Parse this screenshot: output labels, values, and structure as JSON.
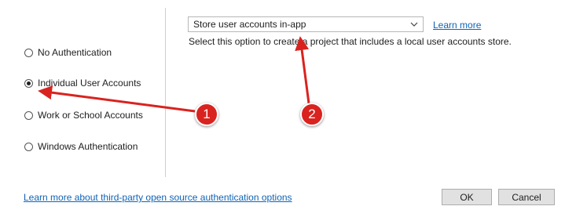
{
  "auth_options": [
    {
      "label": "No Authentication",
      "checked": false
    },
    {
      "label": "Individual User Accounts",
      "checked": true
    },
    {
      "label": "Work or School Accounts",
      "checked": false
    },
    {
      "label": "Windows Authentication",
      "checked": false
    }
  ],
  "store_select": {
    "value": "Store user accounts in-app"
  },
  "learn_more_label": "Learn more",
  "description": "Select this option to create a project that includes a local user accounts store.",
  "footer": {
    "third_party_link": "Learn more about third-party open source authentication options"
  },
  "buttons": {
    "ok": "OK",
    "cancel": "Cancel"
  },
  "annotations": {
    "badge1": "1",
    "badge2": "2",
    "color": "#d9231f"
  }
}
